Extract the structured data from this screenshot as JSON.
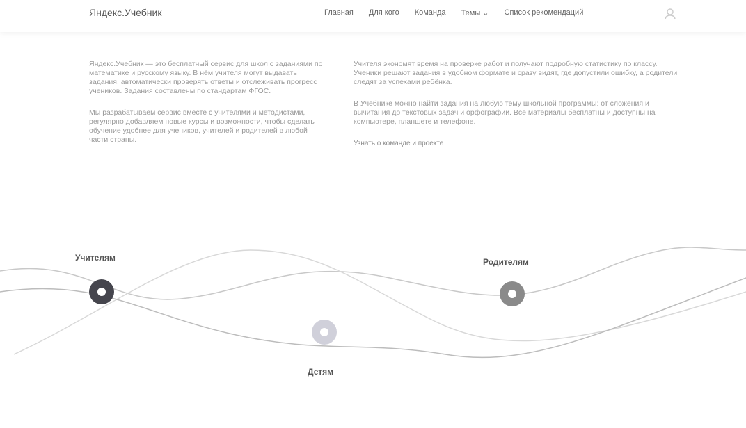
{
  "header": {
    "logo": "Яндекс.Учебник",
    "nav": [
      "Главная",
      "Для кого",
      "Команда",
      "Темы",
      "Список рекомендаций"
    ],
    "icons": [
      "user-icon"
    ]
  },
  "content": {
    "left_paragraphs": [
      "Яндекс.Учебник — это бесплатный сервис для школ с заданиями по математике и русскому языку. В нём учителя могут выдавать задания, автоматически проверять ответы и отслеживать прогресс учеников. Задания составлены по стандартам ФГОС.",
      "Мы разрабатываем сервис вместе с учителями и методистами, регулярно добавляем новые курсы и возможности, чтобы сделать обучение удобнее для учеников, учителей и родителей в любой части страны."
    ],
    "right_paragraphs": [
      "Учителя экономят время на проверке работ и получают подробную статистику по классу. Ученики решают задания в удобном формате и сразу видят, где допустили ошибку, а родители следят за успехами ребёнка.",
      "В Учебнике можно найти задания на любую тему школьной программы: от сложения и вычитания до текстовых задач и орфографии. Все материалы бесплатны и доступны на компьютере, планшете и телефоне."
    ],
    "link": "Узнать о команде и проекте"
  },
  "waves": {
    "teachers_label": "Учителям",
    "parents_label": "Родителям",
    "kids_label": "Детям",
    "colors": {
      "dark": "#45454d",
      "mid": "#8a8a8a",
      "light": "#d0d0da",
      "line": "#bdbdbd"
    }
  }
}
